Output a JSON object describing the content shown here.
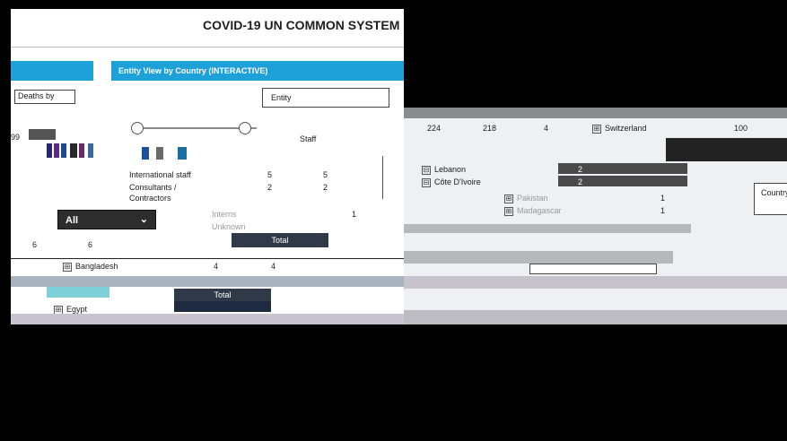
{
  "header": {
    "title": "COVID-19 UN COMMON SYSTEM",
    "sub1": "",
    "sub2": ""
  },
  "tabs": {
    "left_label": "",
    "right_label": "Entity View by Country (INTERACTIVE)"
  },
  "filters": {
    "deaths_label": "Deaths by",
    "entity_label": "Entity",
    "select_value": "All"
  },
  "numbers": {
    "left_count": "99",
    "left_a": "6",
    "left_b": "6"
  },
  "staff_table": {
    "rows": [
      {
        "label": "Staff",
        "c1": "224",
        "c2": "218",
        "c3": "4"
      },
      {
        "label": "International staff",
        "c1": "5",
        "c2": "5",
        "c3": ""
      },
      {
        "label": "Consultants /",
        "c1": "2",
        "c2": "2",
        "c3": ""
      },
      {
        "label": "Contractors",
        "c1": "",
        "c2": "",
        "c3": ""
      },
      {
        "label": "Interns",
        "c1": "1",
        "c2": "1",
        "c3": ""
      },
      {
        "label": "Unknown",
        "c1": "",
        "c2": "",
        "c3": ""
      }
    ]
  },
  "countries": {
    "left": [
      {
        "name": "Bangladesh",
        "value": "4",
        "value2": "4"
      },
      {
        "name": "Egypt",
        "value": "",
        "value2": ""
      }
    ],
    "mid": [
      {
        "name": "Lebanon",
        "value": "2"
      },
      {
        "name": "Côte D'Ivoire",
        "value": "2"
      },
      {
        "name": "Pakistan",
        "value": "1"
      },
      {
        "name": "Madagascar",
        "value": "1"
      }
    ],
    "right": [
      {
        "name": "Switzerland",
        "value": "100"
      }
    ]
  },
  "buttons": {
    "total1": "Total",
    "total2": "Total",
    "country_label": "Country"
  }
}
